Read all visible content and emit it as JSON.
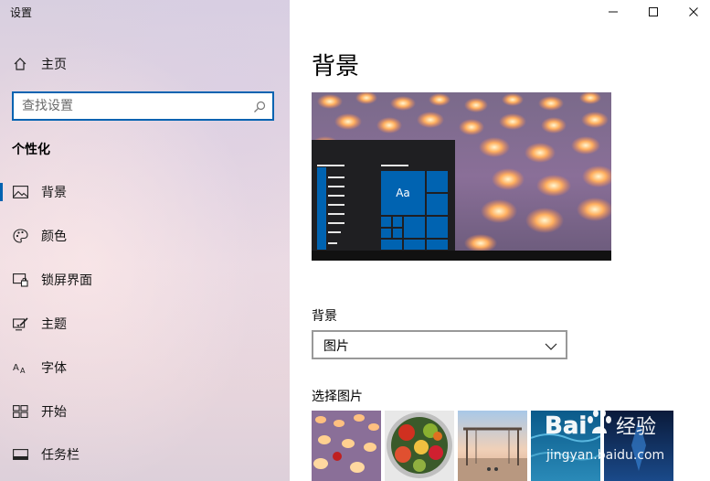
{
  "window": {
    "title": "设置",
    "controls": [
      "minimize",
      "maximize",
      "close"
    ]
  },
  "sidebar": {
    "home": {
      "label": "主页",
      "icon": "home-icon"
    },
    "search": {
      "placeholder": "查找设置",
      "value": ""
    },
    "section_title": "个性化",
    "items": [
      {
        "label": "背景",
        "icon": "picture-icon",
        "selected": true
      },
      {
        "label": "颜色",
        "icon": "palette-icon"
      },
      {
        "label": "锁屏界面",
        "icon": "lock-screen-icon"
      },
      {
        "label": "主题",
        "icon": "theme-brush-icon"
      },
      {
        "label": "字体",
        "icon": "font-icon"
      },
      {
        "label": "开始",
        "icon": "start-grid-icon"
      },
      {
        "label": "任务栏",
        "icon": "taskbar-icon"
      }
    ]
  },
  "main": {
    "title": "背景",
    "preview": {
      "tile_label": "Aa"
    },
    "background_label": "背景",
    "background_select": {
      "value": "图片"
    },
    "choose_picture_label": "选择图片",
    "thumbnails": [
      "lanterns",
      "fruit-bowl",
      "beach-pier",
      "blue-water",
      "night-sky"
    ]
  },
  "watermark": {
    "logo": "Bai度经验",
    "url": "jingyan.baidu.com"
  },
  "colors": {
    "accent": "#0063b1"
  }
}
